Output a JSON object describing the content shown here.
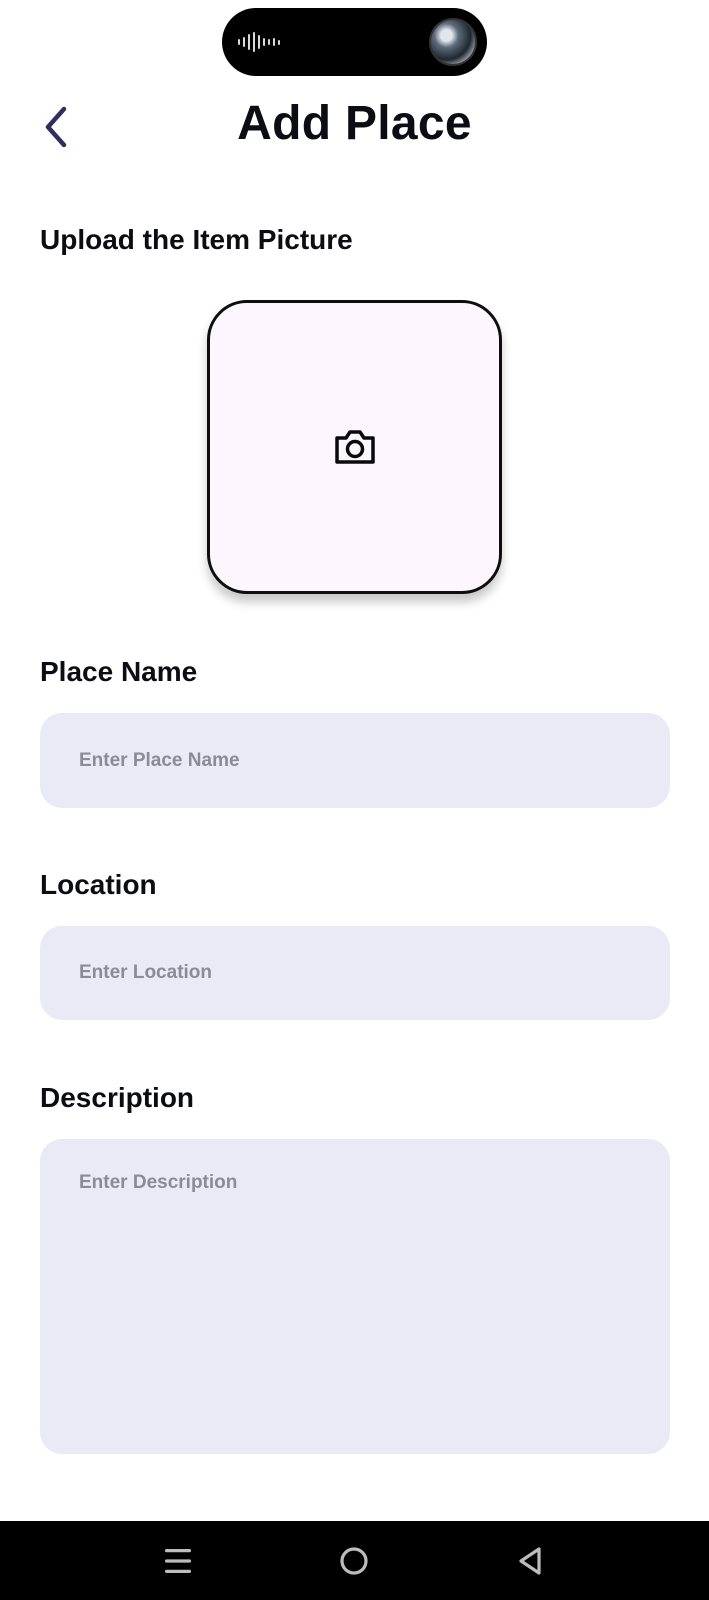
{
  "header": {
    "title": "Add Place"
  },
  "upload": {
    "label": "Upload the Item Picture"
  },
  "place_name": {
    "label": "Place Name",
    "placeholder": "Enter Place Name",
    "value": ""
  },
  "location": {
    "label": "Location",
    "placeholder": "Enter Location",
    "value": ""
  },
  "description": {
    "label": "Description",
    "placeholder": "Enter Description",
    "value": ""
  },
  "icons": {
    "back": "chevron-left-icon",
    "upload": "camera-icon",
    "nav_menu": "menu-icon",
    "nav_home": "home-circle-icon",
    "nav_back": "triangle-back-icon"
  },
  "colors": {
    "accent": "#2f2f5e",
    "input_bg": "#e9eaf6",
    "upload_bg": "#fcf6fe"
  }
}
